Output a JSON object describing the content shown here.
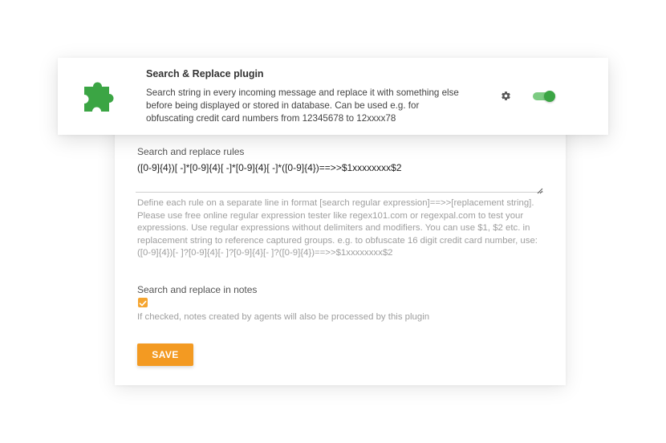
{
  "plugin": {
    "title": "Search & Replace plugin",
    "description_lines": [
      "Search string in every incoming message and replace it with something else",
      "before being displayed or stored in database. Can be used e.g. for",
      "obfuscating credit card numbers from 12345678 to 12xxxx78"
    ],
    "enabled": true,
    "icon": "puzzle-icon",
    "settings_icon": "gear-icon",
    "colors": {
      "icon": "#3ba544",
      "toggle": "#3ba544"
    }
  },
  "form": {
    "rules_label": "Search and replace rules",
    "rules_value": "([0-9]{4})[ -]*[0-9]{4}[ -]*[0-9]{4}[ -]*([0-9]{4})==>>$1xxxxxxxx$2",
    "help_lines": [
      "Define each rule on a separate line in format [search regular expression]==>>[replacement string].",
      "Please use free online regular expression tester like regex101.com or regexpal.com to test your",
      "expressions. Use regular expressions without delimiters and modifiers. You can use $1, $2 etc. in",
      "replacement string to reference captured groups. e.g. to obfuscate 16 digit credit card number, use:",
      "([0-9]{4})[- ]?[0-9]{4}[- ]?[0-9]{4}[- ]?([0-9]{4})==>>$1xxxxxxxx$2"
    ],
    "notes_label": "Search and replace in notes",
    "notes_checked": true,
    "notes_help": "If checked, notes created by agents will also be processed by this plugin",
    "save_label": "SAVE",
    "colors": {
      "accent": "#f39a22"
    }
  }
}
